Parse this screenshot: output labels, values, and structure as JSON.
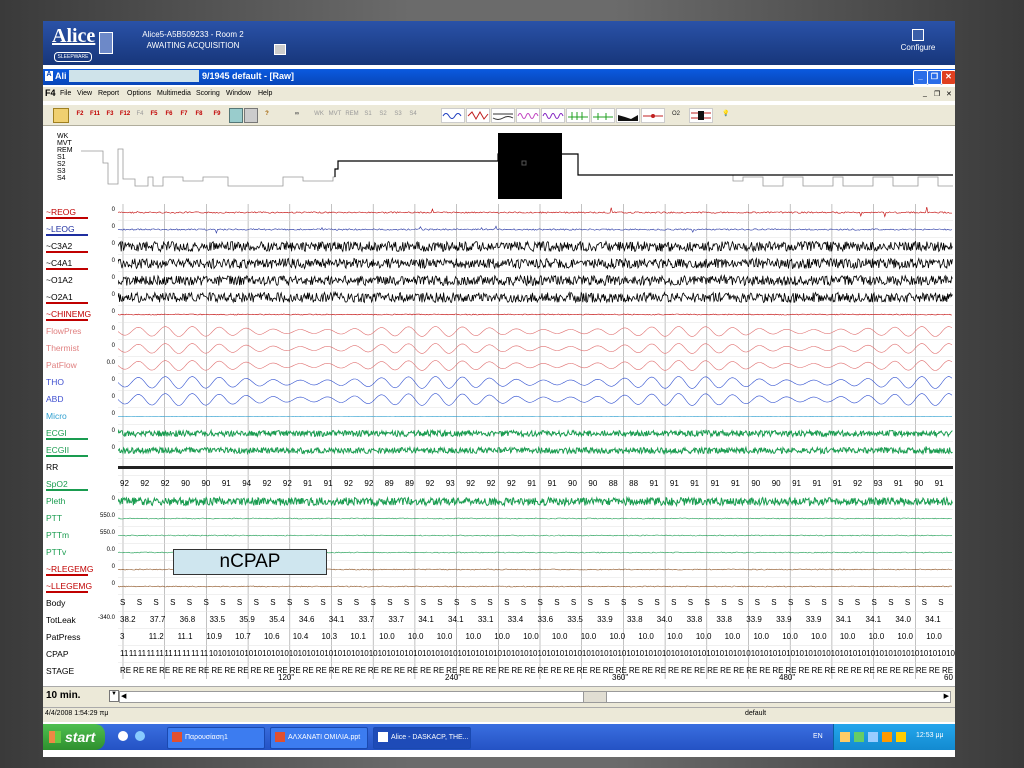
{
  "banner": {
    "logo": "Alice",
    "logo_sub": "SLEEPWARE",
    "info_line1": "Alice5-A5B509233 - Room 2",
    "info_line2": "AWAITING ACQUISITION",
    "configure_label": "Configure"
  },
  "window": {
    "title_prefix": "Ali",
    "title_suffix": "9/1945 default - [Raw]"
  },
  "menu": {
    "app_key": "F4",
    "items": [
      "File",
      "View",
      "Report",
      "Options",
      "Multimedia",
      "Scoring",
      "Window",
      "Help"
    ]
  },
  "toolbar": {
    "fkeys": [
      "F2",
      "F11",
      "F3",
      "F12",
      "F4",
      "F5",
      "F6",
      "F7",
      "F8",
      "F9"
    ],
    "stage_buttons": [
      "WK",
      "MVT",
      "REM",
      "S1",
      "S2",
      "S3",
      "S4"
    ],
    "o2_label": "O2"
  },
  "hypnogram": {
    "stage_labels": [
      "WK",
      "MVT",
      "REM",
      "S1",
      "S2",
      "S3",
      "S4"
    ]
  },
  "channels": [
    {
      "label": "~REOG",
      "scale": "0",
      "color": "#c00000",
      "underline": "#c00000"
    },
    {
      "label": "~LEOG",
      "scale": "0",
      "color": "#1f2fa0",
      "underline": "#1f2fa0"
    },
    {
      "label": "~C3A2",
      "scale": "0",
      "color": "#000000",
      "underline": "#c00000"
    },
    {
      "label": "~C4A1",
      "scale": "0",
      "color": "#000000",
      "underline": "#c00000"
    },
    {
      "label": "~O1A2",
      "scale": "0",
      "color": "#000000",
      "underline": ""
    },
    {
      "label": "~O2A1",
      "scale": "0",
      "color": "#000000",
      "underline": "#c00000"
    },
    {
      "label": "~CHINEMG",
      "scale": "0",
      "color": "#c00000",
      "underline": "#c00000"
    },
    {
      "label": "FlowPres",
      "scale": "0",
      "color": "#e08080",
      "underline": ""
    },
    {
      "label": "Thermist",
      "scale": "0",
      "color": "#e08080",
      "underline": ""
    },
    {
      "label": "PatFlow",
      "scale": "0.0",
      "color": "#e08080",
      "underline": ""
    },
    {
      "label": "THO",
      "scale": "0",
      "color": "#4050d0",
      "underline": ""
    },
    {
      "label": "ABD",
      "scale": "0",
      "color": "#4050d0",
      "underline": ""
    },
    {
      "label": "Micro",
      "scale": "0",
      "color": "#30a0d0",
      "underline": ""
    },
    {
      "label": "ECGI",
      "scale": "0",
      "color": "#1a9c50",
      "underline": "#1a9c50"
    },
    {
      "label": "ECGII",
      "scale": "0",
      "color": "#1a9c50",
      "underline": "#1a9c50"
    },
    {
      "label": "RR",
      "scale": "",
      "color": "#000000",
      "underline": ""
    },
    {
      "label": "SpO2",
      "scale": "",
      "color": "#1a9c50",
      "underline": "#1a9c50"
    },
    {
      "label": "Pleth",
      "scale": "0",
      "color": "#1a9c50",
      "underline": ""
    },
    {
      "label": "PTT",
      "scale": "550.0",
      "color": "#1a9c50",
      "underline": ""
    },
    {
      "label": "PTTm",
      "scale": "550.0",
      "color": "#1a9c50",
      "underline": ""
    },
    {
      "label": "PTTv",
      "scale": "0.0",
      "color": "#1a9c50",
      "underline": ""
    },
    {
      "label": "~RLEGEMG",
      "scale": "0",
      "color": "#c00000",
      "underline": "#c00000"
    },
    {
      "label": "~LLEGEMG",
      "scale": "0",
      "color": "#c00000",
      "underline": "#c00000"
    },
    {
      "label": "Body",
      "scale": "",
      "color": "#000000",
      "underline": ""
    },
    {
      "label": "TotLeak",
      "scale": "-340.0",
      "color": "#000000",
      "underline": ""
    },
    {
      "label": "PatPress",
      "scale": "",
      "color": "#000000",
      "underline": ""
    },
    {
      "label": "CPAP",
      "scale": "",
      "color": "#000000",
      "underline": ""
    },
    {
      "label": "STAGE",
      "scale": "",
      "color": "#000000",
      "underline": ""
    }
  ],
  "spo2_values": [
    "92",
    "92",
    "92",
    "90",
    "90",
    "91",
    "94",
    "92",
    "92",
    "91",
    "91",
    "92",
    "92",
    "89",
    "89",
    "92",
    "93",
    "92",
    "92",
    "92",
    "91",
    "91",
    "90",
    "90",
    "88",
    "88",
    "91",
    "91",
    "91",
    "91",
    "91",
    "90",
    "90",
    "91",
    "91",
    "91",
    "92",
    "93",
    "91",
    "90",
    "91"
  ],
  "body_values": [
    "S",
    "S",
    "S",
    "S",
    "S",
    "S",
    "S",
    "S",
    "S",
    "S",
    "S",
    "S",
    "S",
    "S",
    "S",
    "S",
    "S",
    "S",
    "S",
    "S",
    "S",
    "S",
    "S",
    "S",
    "S",
    "S",
    "S",
    "S",
    "S",
    "S",
    "S",
    "S",
    "S",
    "S",
    "S",
    "S",
    "S",
    "S",
    "S",
    "S",
    "S",
    "S",
    "S",
    "S",
    "S",
    "S",
    "S",
    "S",
    "S",
    "S"
  ],
  "totleak_values": [
    "38.2",
    "37.7",
    "36.8",
    "33.5",
    "35.9",
    "35.4",
    "34.6",
    "34.1",
    "33.7",
    "33.7",
    "34.1",
    "34.1",
    "33.1",
    "33.4",
    "33.6",
    "33.5",
    "33.9",
    "33.8",
    "34.0",
    "33.8",
    "33.8",
    "33.9",
    "33.9",
    "33.9",
    "34.1",
    "34.1",
    "34.0",
    "34.1"
  ],
  "patpress_values": [
    "3",
    "11.2",
    "11.1",
    "10.9",
    "10.7",
    "10.6",
    "10.4",
    "10.3",
    "10.1",
    "10.0",
    "10.0",
    "10.0",
    "10.0",
    "10.0",
    "10.0",
    "10.0",
    "10.0",
    "10.0",
    "10.0",
    "10.0",
    "10.0",
    "10.0",
    "10.0",
    "10.0",
    "10.0",
    "10.0",
    "10.0",
    "10.0",
    "10.0"
  ],
  "cpap_values": [
    "11",
    "11",
    "11",
    "11",
    "11",
    "11",
    "11",
    "11",
    "11",
    "11",
    "10",
    "10",
    "10",
    "10",
    "10",
    "10",
    "10",
    "10",
    "10",
    "10",
    "10",
    "10",
    "10",
    "10",
    "10",
    "10",
    "10",
    "10",
    "10",
    "10",
    "10",
    "10",
    "10",
    "10",
    "10",
    "10",
    "10",
    "10",
    "10",
    "10",
    "10",
    "10",
    "10",
    "10",
    "10",
    "10",
    "10",
    "10",
    "10",
    "10",
    "10",
    "10",
    "10",
    "10",
    "10",
    "10",
    "10",
    "10",
    "10",
    "10",
    "10",
    "10",
    "10",
    "10",
    "10",
    "10",
    "10",
    "10",
    "10",
    "10",
    "10",
    "10",
    "10",
    "10",
    "10",
    "10",
    "10",
    "10",
    "10",
    "10",
    "10",
    "10",
    "10",
    "10",
    "10",
    "10",
    "10",
    "10",
    "10",
    "10",
    "10",
    "10",
    "10",
    "10"
  ],
  "stage_values": [
    "RE",
    "RE",
    "RE",
    "RE",
    "RE",
    "RE",
    "RE",
    "RE",
    "RE",
    "RE",
    "RE",
    "RE",
    "RE",
    "RE",
    "RE",
    "RE",
    "RE",
    "RE",
    "RE",
    "RE",
    "RE",
    "RE",
    "RE",
    "RE",
    "RE",
    "RE",
    "RE",
    "RE",
    "RE",
    "RE",
    "RE",
    "RE",
    "RE",
    "RE",
    "RE",
    "RE",
    "RE",
    "RE",
    "RE",
    "RE",
    "RE",
    "RE",
    "RE",
    "RE",
    "RE",
    "RE",
    "RE",
    "RE",
    "RE",
    "RE",
    "RE",
    "RE",
    "RE",
    "RE",
    "RE",
    "RE",
    "RE",
    "RE",
    "RE",
    "RE",
    "RE",
    "RE",
    "RE",
    "RE"
  ],
  "annotation": "nCPAP",
  "time_axis": [
    "120\"",
    "240\"",
    "360\"",
    "480\"",
    "60"
  ],
  "epoch": "10 min.",
  "status": {
    "datetime": "4/4/2008 1:54:29 πμ",
    "profile": "default"
  },
  "taskbar": {
    "start": "start",
    "items": [
      "Παρουσίαση1",
      "ΑΛΧΑΝΑΤΙ ΟΜΙΛΙΑ.ppt",
      "Alice - DASKACP, THE..."
    ],
    "lang": "EN",
    "clock": "12:53 μμ"
  }
}
